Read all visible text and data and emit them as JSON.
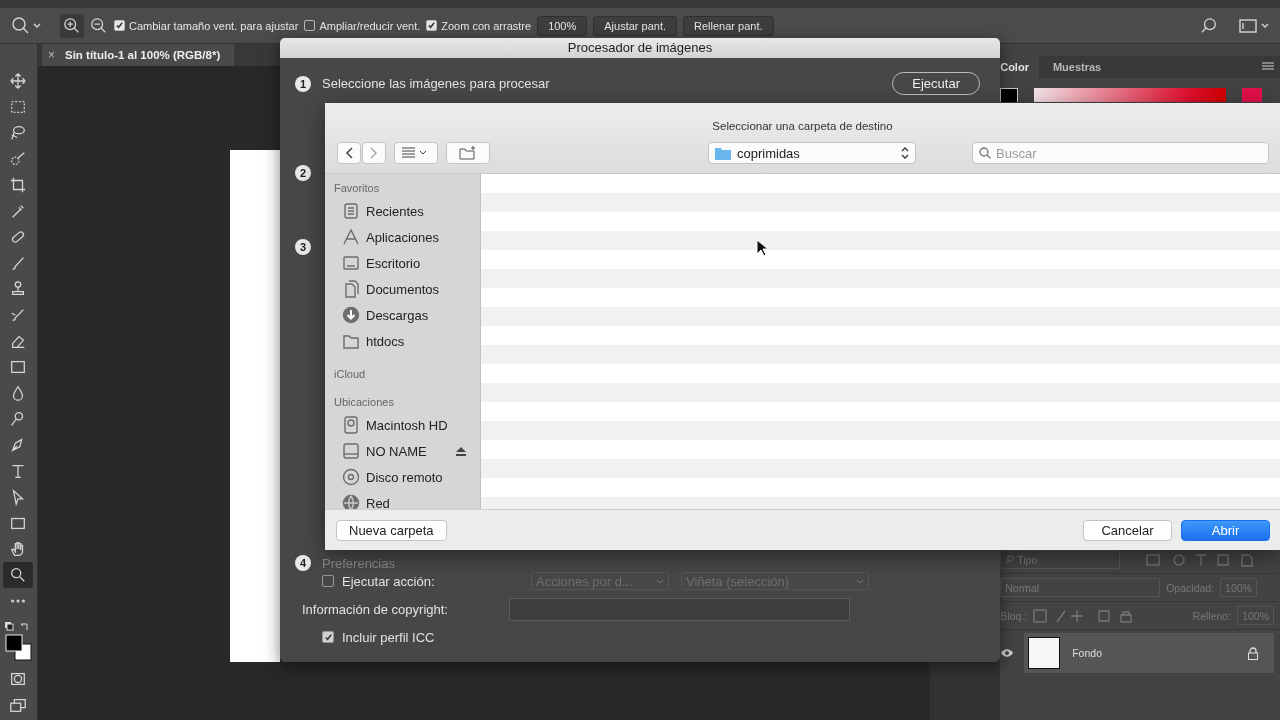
{
  "options_bar": {
    "toggles": [
      {
        "label": "Cambiar tamaño vent. para ajustar",
        "checked": true
      },
      {
        "label": "Ampliar/reducir vent.",
        "checked": false
      },
      {
        "label": "Zoom con arrastre",
        "checked": true
      }
    ],
    "buttons": [
      "100%",
      "Ajustar pant.",
      "Rellenar pant."
    ]
  },
  "tools": [
    {
      "kind": "move",
      "selected": false
    },
    {
      "kind": "marquee",
      "selected": false
    },
    {
      "kind": "lasso",
      "selected": false
    },
    {
      "kind": "quick-select",
      "selected": false
    },
    {
      "kind": "crop",
      "selected": false
    },
    {
      "kind": "eyedropper",
      "selected": false
    },
    {
      "kind": "bandage",
      "selected": false
    },
    {
      "kind": "brush",
      "selected": false
    },
    {
      "kind": "stamp",
      "selected": false
    },
    {
      "kind": "history-brush",
      "selected": false
    },
    {
      "kind": "eraser",
      "selected": false
    },
    {
      "kind": "gradient",
      "selected": false
    },
    {
      "kind": "drop",
      "selected": false
    },
    {
      "kind": "dodge",
      "selected": false
    },
    {
      "kind": "pen",
      "selected": false
    },
    {
      "kind": "type",
      "selected": false
    },
    {
      "kind": "pointer",
      "selected": false
    },
    {
      "kind": "rectangle",
      "selected": false
    },
    {
      "kind": "hand",
      "selected": false
    },
    {
      "kind": "zoom",
      "selected": true
    },
    {
      "kind": "more",
      "selected": false
    }
  ],
  "document_tab": {
    "close": "×",
    "title": "Sin título-1 al 100% (RGB/8*)"
  },
  "color_panel": {
    "tabs": [
      {
        "label": "Color",
        "selected": true
      },
      {
        "label": "Muestras",
        "selected": false
      }
    ]
  },
  "layers_panel": {
    "filter_placeholder": "Tipo",
    "blend_mode": "Normal",
    "opacity_label": "Opacidad:",
    "opacity": "100%",
    "lock_label": "Bloq.:",
    "fill_label": "Relleno:",
    "fill": "100%",
    "layers": [
      {
        "name": "Fondo",
        "visible": true,
        "locked": true
      }
    ]
  },
  "image_processor": {
    "title": "Procesador de imágenes",
    "sections": [
      {
        "number": "1",
        "title": "Seleccione las imágenes para procesar"
      },
      {
        "number": "2"
      },
      {
        "number": "3"
      },
      {
        "number": "4",
        "title": "Preferencias"
      }
    ],
    "run_button": "Ejecutar",
    "run_action": {
      "label": "Ejecutar acción:",
      "checked": false
    },
    "dropdowns": [
      {
        "value": "Acciones por d...",
        "disabled": true
      },
      {
        "value": "Viñeta (selección)",
        "disabled": true
      }
    ],
    "copyright_label": "Información de copyright:",
    "icc_profile": {
      "label": "Incluir perfil ICC",
      "checked": true
    }
  },
  "folder_sheet": {
    "title": "Seleccionar una carpeta de destino",
    "location": "coprimidas",
    "search_placeholder": "Buscar",
    "sidebar": [
      {
        "heading": "Favoritos",
        "items": [
          {
            "kind": "recent",
            "label": "Recientes"
          },
          {
            "kind": "apps",
            "label": "Aplicaciones"
          },
          {
            "kind": "desktop",
            "label": "Escritorio"
          },
          {
            "kind": "documents",
            "label": "Documentos"
          },
          {
            "kind": "downloads",
            "label": "Descargas"
          },
          {
            "kind": "folder",
            "label": "htdocs"
          }
        ]
      },
      {
        "heading": "iCloud"
      },
      {
        "heading": "Ubicaciones",
        "items": [
          {
            "kind": "hard-disk",
            "label": "Macintosh HD"
          },
          {
            "kind": "drive",
            "label": "NO NAME",
            "ejectable": true
          },
          {
            "kind": "disc",
            "label": "Disco remoto"
          },
          {
            "kind": "network",
            "label": "Red"
          }
        ]
      }
    ],
    "new_folder_button": "Nueva carpeta",
    "cancel_button": "Cancelar",
    "open_button": "Abrir"
  }
}
